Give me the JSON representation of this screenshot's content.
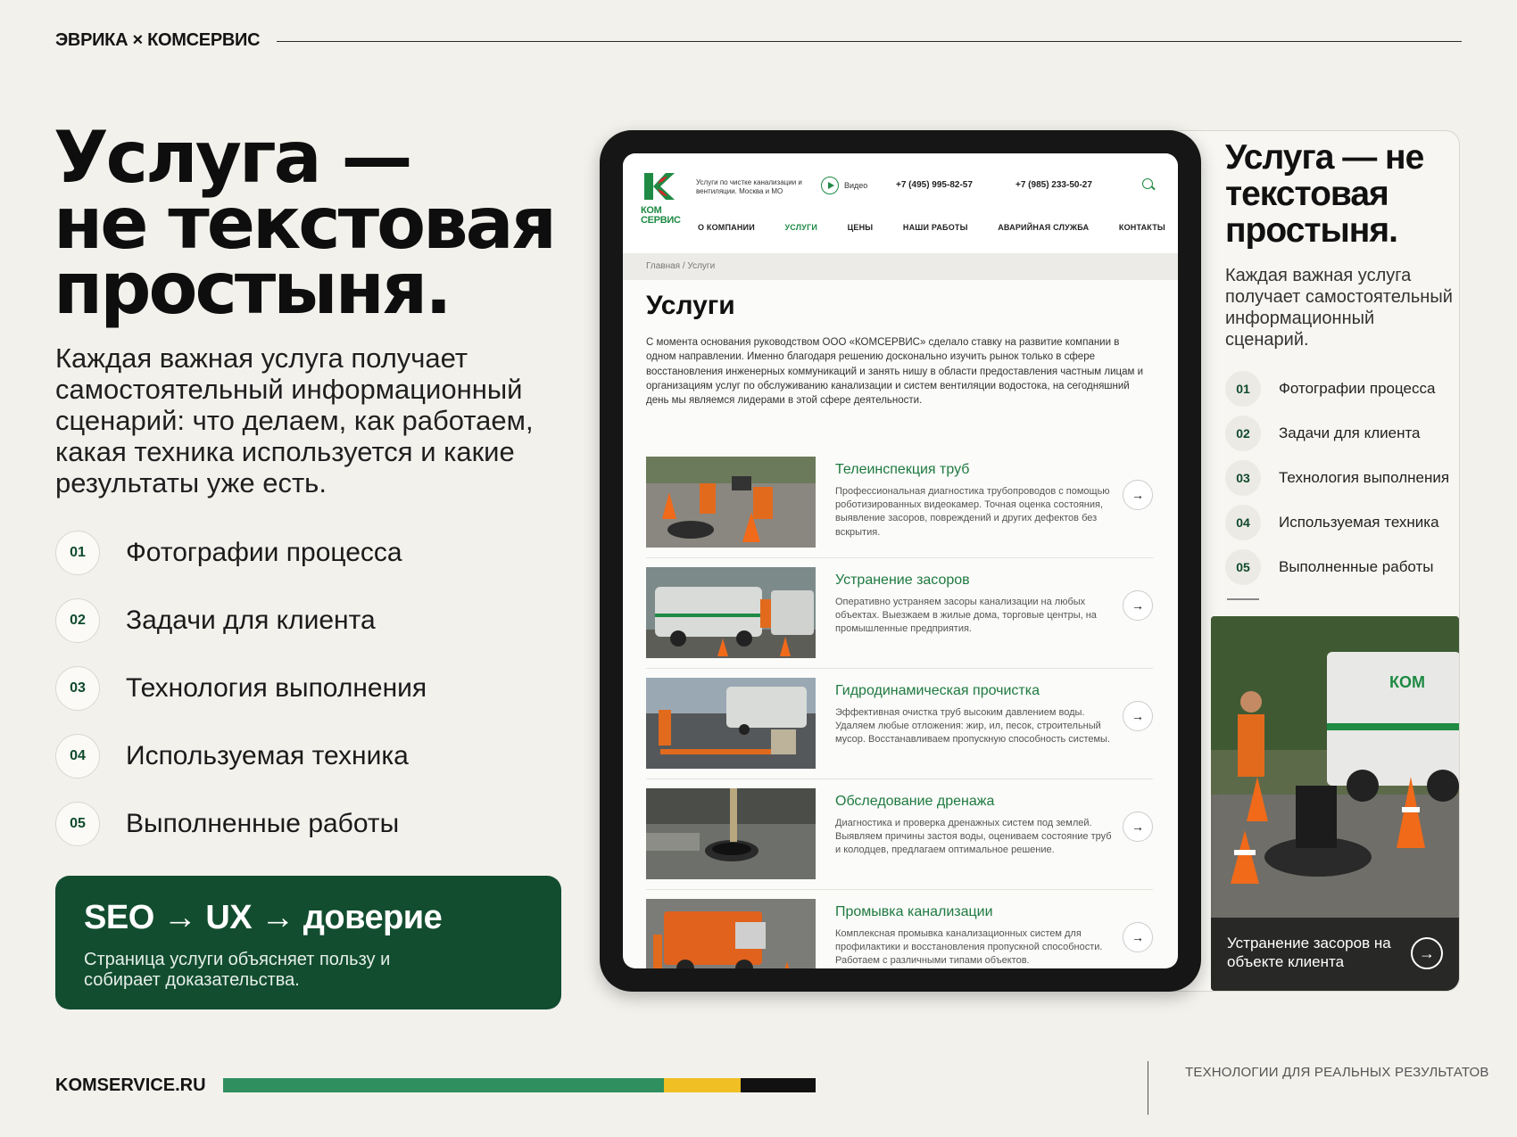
{
  "brand": "ЭВРИКА × КОМСЕРВИС",
  "hero": {
    "title_lines": [
      "Услуга —",
      "не текстовая",
      "простыня."
    ],
    "lead": "Каждая важная услуга получает самостоятельный информационный сценарий: что делаем, как работаем, какая техника используется и какие результаты уже есть."
  },
  "steps": [
    {
      "num": "01",
      "label": "Фотографии процесса"
    },
    {
      "num": "02",
      "label": "Задачи для клиента"
    },
    {
      "num": "03",
      "label": "Технология выполнения"
    },
    {
      "num": "04",
      "label": "Используемая техника"
    },
    {
      "num": "05",
      "label": "Выполненные работы"
    }
  ],
  "cta": {
    "title": "SEO → UX → доверие",
    "text": "Страница услуги объясняет пользу и собирает доказательства."
  },
  "footer": {
    "site": "KOMSERVICE.RU",
    "tagline": "ТЕХНОЛОГИИ ДЛЯ РЕАЛЬНЫХ РЕЗУЛЬТАТОВ",
    "bar_colors": [
      "#2f8f5f",
      "#f0bf23",
      "#111111"
    ]
  },
  "tablet": {
    "logo_text": "КОМ СЕРВИС",
    "header_desc": "Услуги по чистке канализации и вентиляции. Москва и МО",
    "video_label": "Видео",
    "phone1": "+7 (495) 995-82-57",
    "phone2": "+7 (985) 233-50-27",
    "nav": [
      "О КОМПАНИИ",
      "УСЛУГИ",
      "ЦЕНЫ",
      "НАШИ РАБОТЫ",
      "АВАРИЙНАЯ СЛУЖБА",
      "КОНТАКТЫ"
    ],
    "nav_active": "УСЛУГИ",
    "breadcrumb": "Главная  /  Услуги",
    "page_title": "Услуги",
    "intro": "С момента основания руководством ООО «КОМСЕРВИС» сделало ставку на развитие компании в одном направлении. Именно благодаря решению досконально изучить рынок только в сфере восстановления инженерных коммуникаций и занять нишу в области предоставления частным лицам и организациям услуг по обслуживанию канализации и систем вентиляции водостока, на сегодняшний день мы являемся лидерами в этой сфере деятельности.",
    "services": [
      {
        "title": "Телеинспекция труб",
        "desc": "Профессиональная диагностика трубопроводов с помощью роботизированных видеокамер. Точная оценка состояния, выявление засоров, повреждений и других дефектов без вскрытия."
      },
      {
        "title": "Устранение засоров",
        "desc": "Оперативно устраняем засоры канализации на любых объектах. Выезжаем в жилые дома, торговые центры, на промышленные предприятия."
      },
      {
        "title": "Гидродинамическая прочистка",
        "desc": "Эффективная очистка труб высоким давлением воды. Удаляем любые отложения: жир, ил, песок, строительный мусор. Восстанавливаем пропускную способность системы."
      },
      {
        "title": "Обследование дренажа",
        "desc": "Диагностика и проверка дренажных систем под землей. Выявляем причины застоя воды, оцениваем состояние труб и колодцев, предлагаем оптимальное решение."
      },
      {
        "title": "Промывка канализации",
        "desc": "Комплексная промывка канализационных систем для профилактики и восстановления пропускной способности. Работаем с различными типами объектов."
      }
    ],
    "arrow": "→"
  },
  "side": {
    "title": "Услуга — не текстовая простыня.",
    "lead": "Каждая важная услуга получает самостоятельный информационный сценарий.",
    "caption": "Устранение засоров на объекте клиента",
    "arrow": "→"
  },
  "colors": {
    "accent_green": "#124d2f",
    "link_green": "#1e7a40",
    "background": "#f2f1ec"
  }
}
